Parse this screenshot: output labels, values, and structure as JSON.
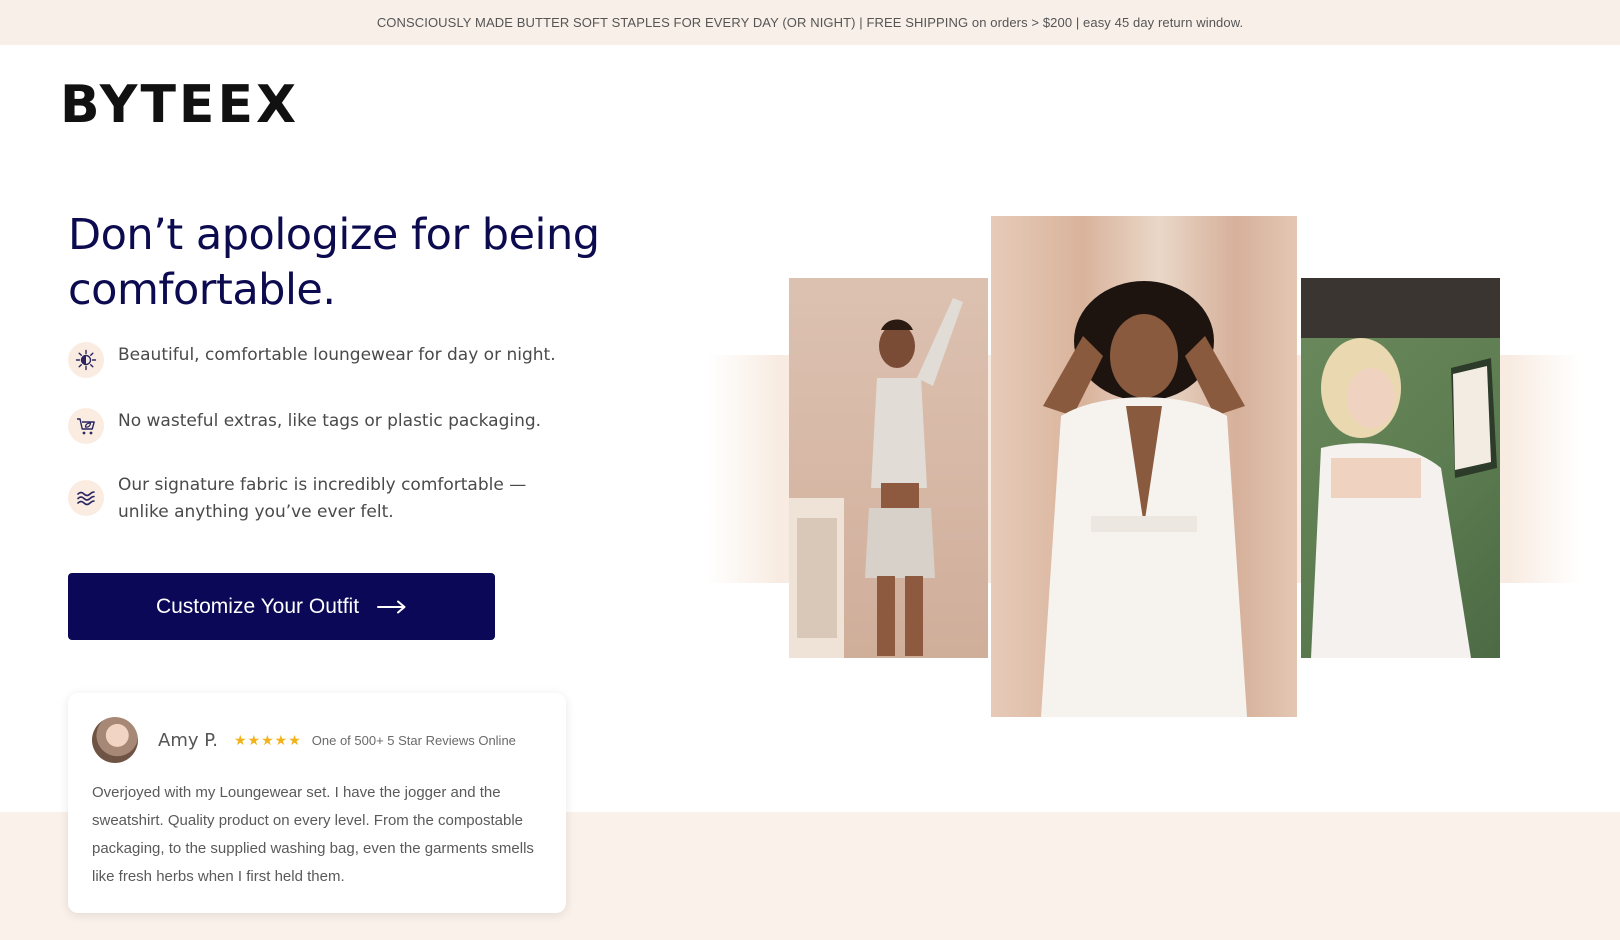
{
  "announcement": "CONSCIOUSLY MADE BUTTER SOFT STAPLES FOR EVERY DAY (OR NIGHT) | FREE SHIPPING on orders > $200 | easy 45 day return window.",
  "brand": "BYTEEX",
  "hero": {
    "headline": "Don’t apologize for being comfortable.",
    "features": [
      {
        "icon": "sun-moon-icon",
        "text": "Beautiful, comfortable loungewear for day or night."
      },
      {
        "icon": "eco-cart-icon",
        "text": "No wasteful extras, like tags or plastic packaging."
      },
      {
        "icon": "waves-icon",
        "text": "Our signature fabric is incredibly comfortable — unlike anything you’ve ever felt."
      }
    ],
    "cta_label": "Customize Your Outfit"
  },
  "review": {
    "name": "Amy P.",
    "stars": "★★★★★",
    "count_text": "One of 500+ 5 Star Reviews Online",
    "body": "Overjoyed with my Loungewear set. I have the jogger and the sweatshirt. Quality product on every level. From the compostable packaging, to the supplied washing bag, even the garments smells like fresh herbs when I first held them."
  },
  "colors": {
    "navy": "#0b0858",
    "headline": "#0d0b4f",
    "announce_bg": "#f8f0e8",
    "star": "#f2b21a"
  }
}
